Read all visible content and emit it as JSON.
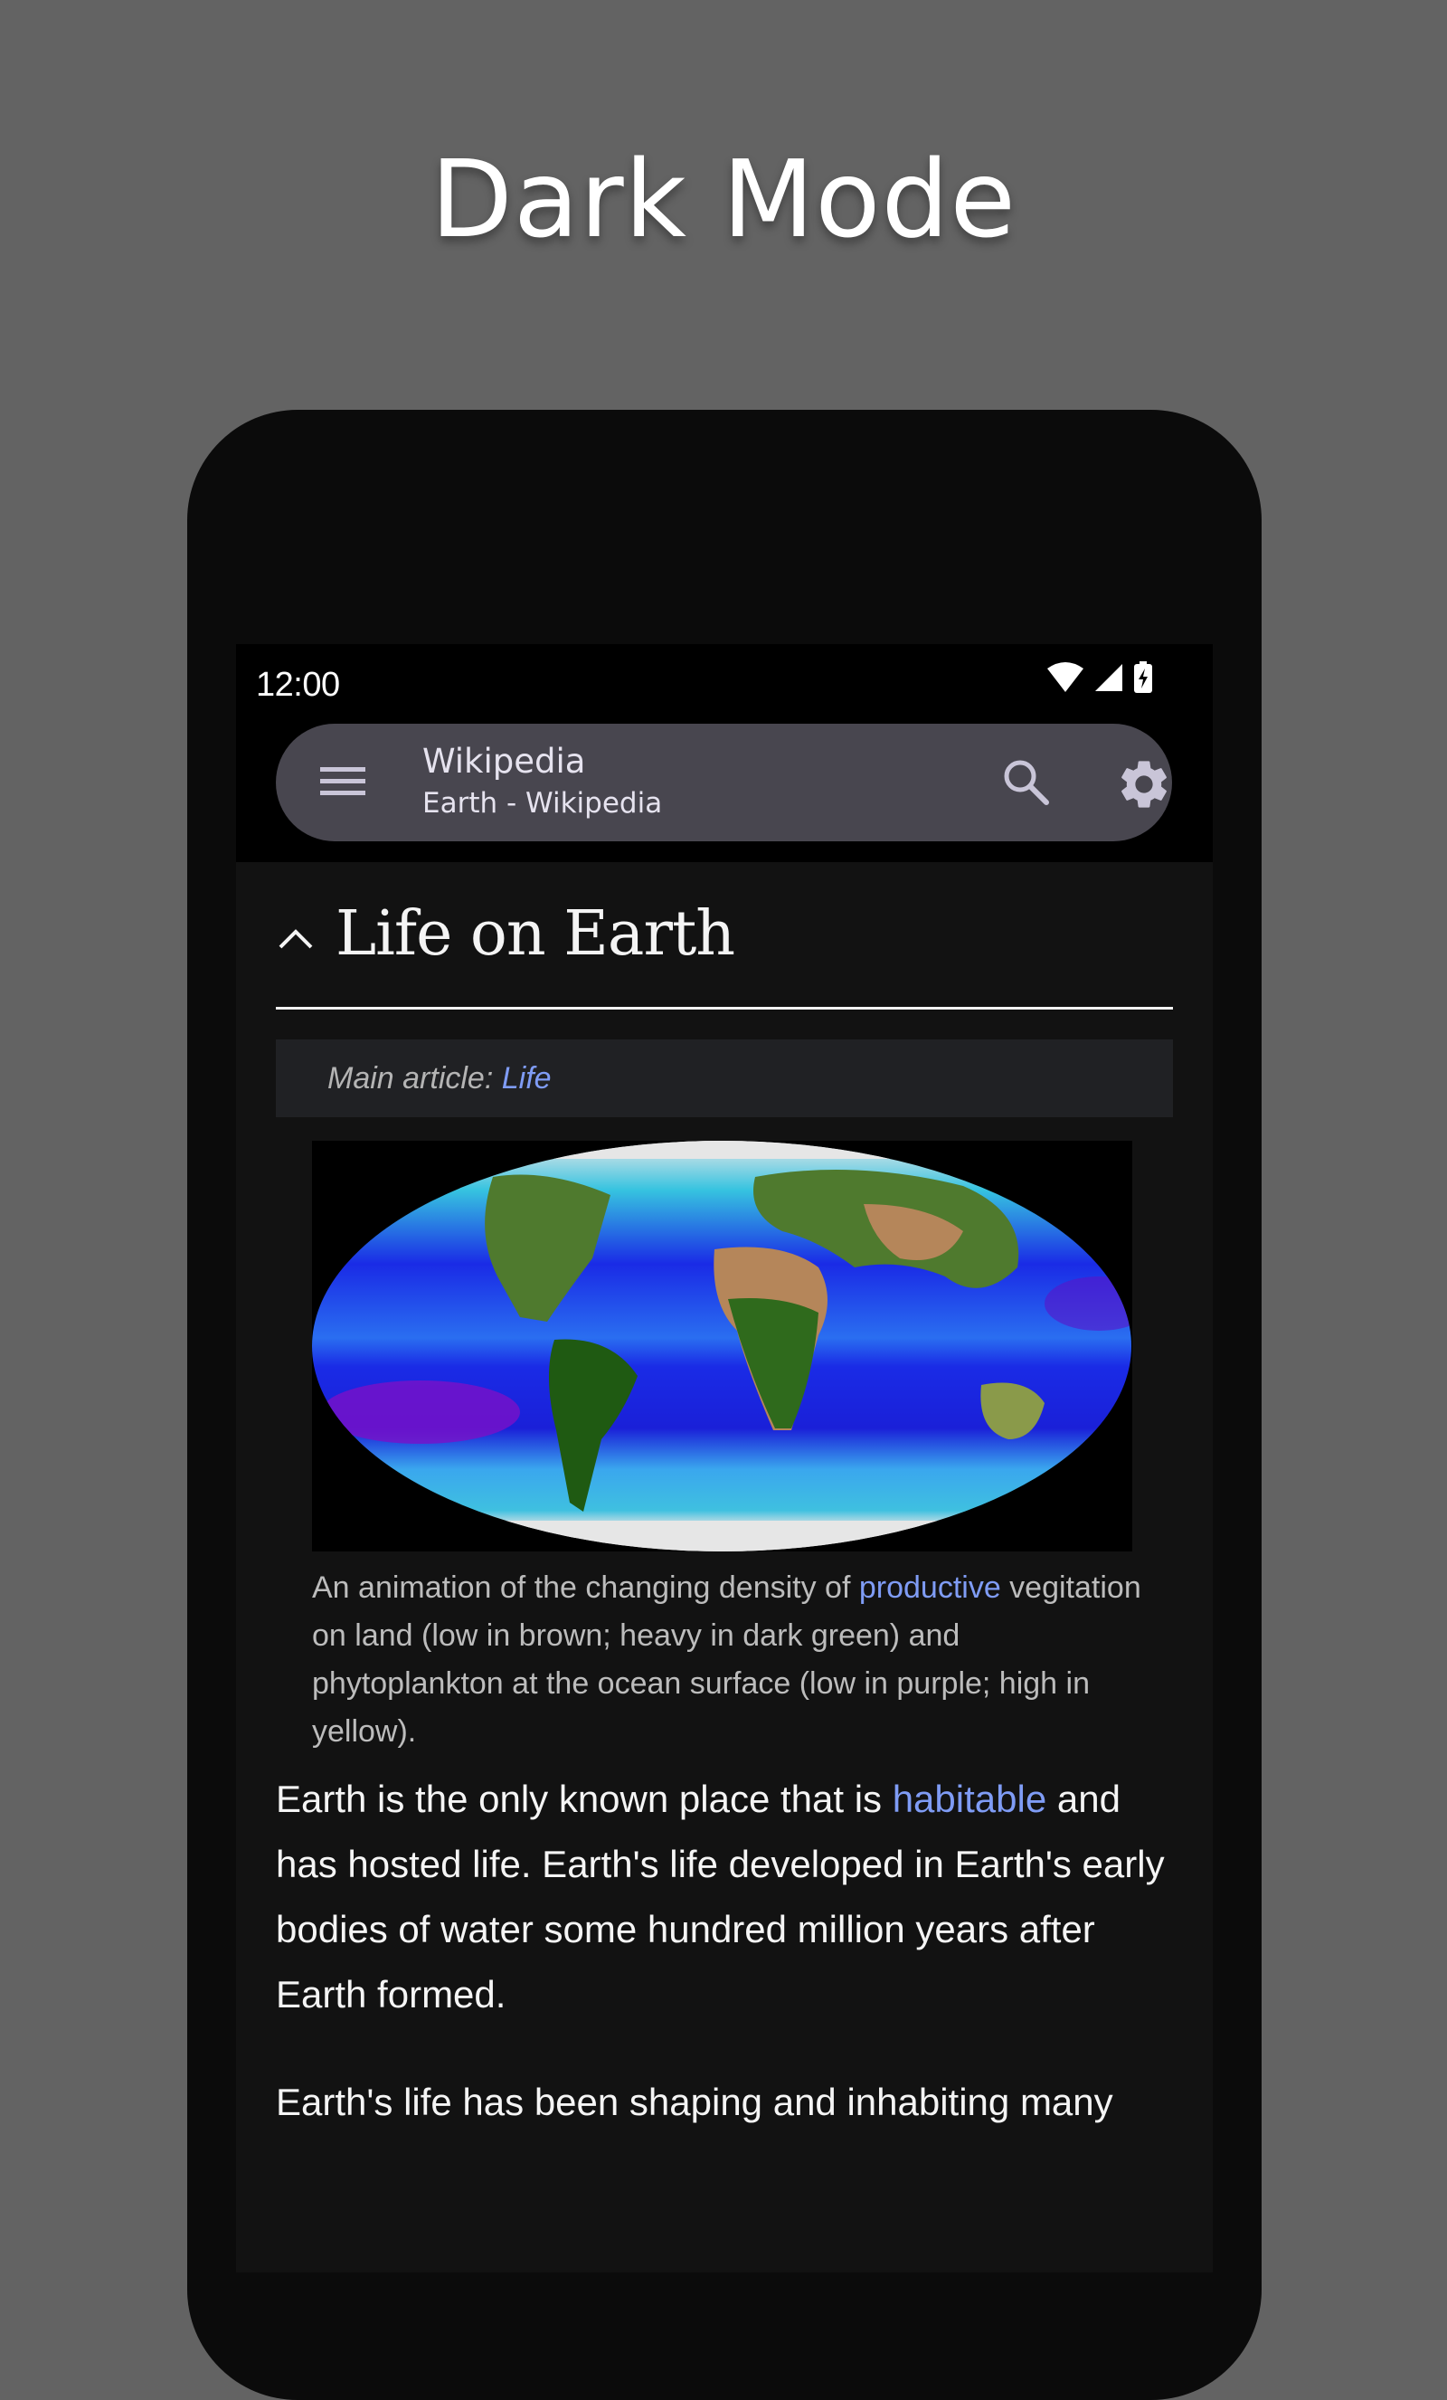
{
  "promo": {
    "title": "Dark Mode"
  },
  "status_bar": {
    "time": "12:00",
    "icons": [
      "wifi-icon",
      "cellular-signal-icon",
      "battery-charging-icon"
    ]
  },
  "toolbar": {
    "menu_icon": "hamburger-menu-icon",
    "title": "Wikipedia",
    "subtitle": "Earth - Wikipedia",
    "search_icon": "search-icon",
    "settings_icon": "gear-icon",
    "pill_color": "#48464f"
  },
  "article": {
    "section_heading": "Life on Earth",
    "section_expanded": true,
    "hatnote": {
      "prefix": "Main article: ",
      "link": "Life"
    },
    "figure": {
      "alt": "World map showing vegetation and phytoplankton density",
      "caption_before_link": "An animation of the changing density of ",
      "caption_link": "productive",
      "caption_after_link": " vegitation on land (low in brown; heavy in dark green) and phytoplankton at the ocean surface (low in purple; high in yellow)."
    },
    "paragraphs": [
      {
        "before_link": "Earth is the only known place that is ",
        "link": "habitable",
        "after_link": " and has hosted life. Earth's life developed in Earth's early bodies of water some hundred million years after Earth formed."
      },
      {
        "text": "Earth's life has been shaping and inhabiting many"
      }
    ]
  },
  "colors": {
    "page_background": "#636363",
    "content_background": "#121212",
    "link": "#7f9cf5",
    "hatnote_background": "#202124"
  }
}
